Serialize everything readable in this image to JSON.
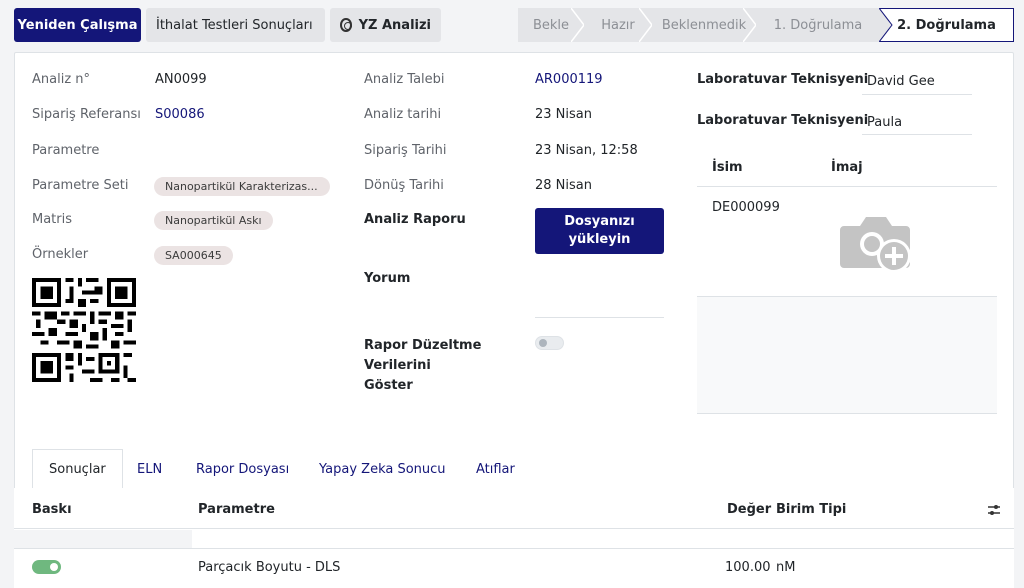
{
  "toolbar": {
    "restart": "Yeniden Çalışma",
    "import_results": "İthalat Testleri Sonuçları",
    "ai_analysis": "YZ Analizi"
  },
  "stages": [
    "Bekle",
    "Hazır",
    "Beklenmedik",
    "1. Doğrulama",
    "2. Doğrulama"
  ],
  "active_stage": "2. Doğrulama",
  "left": {
    "analysis_no_label": "Analiz n°",
    "analysis_no": "AN0099",
    "order_ref_label": "Sipariş Referansı",
    "order_ref": "S00086",
    "parameter_label": "Parametre",
    "parameter_set_label": "Parametre Seti",
    "parameter_set": "Nanopartikül Karakterizas...",
    "matrix_label": "Matris",
    "matrix": "Nanopartikül Askı",
    "samples_label": "Örnekler",
    "sample": "SA000645"
  },
  "middle": {
    "request_label": "Analiz Talebi",
    "request": "AR000119",
    "date_label": "Analiz tarihi",
    "date": "23 Nisan",
    "order_date_label": "Sipariş Tarihi",
    "order_date": "23 Nisan, 12:58",
    "return_date_label": "Dönüş Tarihi",
    "return_date": "28 Nisan",
    "report_label": "Analiz Raporu",
    "upload_label": "Dosyanızı yükleyin",
    "comment_label": "Yorum",
    "show_corrections_label": "Rapor Düzeltme Verilerini Göster",
    "show_corrections": false
  },
  "right": {
    "tech1_label": "Laboratuvar Teknisyeni",
    "tech1": "David Gee",
    "tech2_label": "Laboratuvar Teknisyeni",
    "tech2": "Paula",
    "col_name": "İsim",
    "col_image": "İmaj",
    "row_name": "DE000099"
  },
  "tabs": [
    "Sonuçlar",
    "ELN",
    "Rapor Dosyası",
    "Yapay Zeka Sonucu",
    "Atıflar"
  ],
  "results": {
    "headers": {
      "print": "Baskı",
      "parameter": "Parametre",
      "value": "Değer",
      "unit": "Birim Tipi"
    },
    "rows": [
      {
        "print": true,
        "parameter": "Parçacık Boyutu - DLS",
        "value": "100.00",
        "unit": "nM"
      }
    ]
  },
  "colors": {
    "primary": "#141679",
    "toggle_on": "#6fb87f"
  }
}
